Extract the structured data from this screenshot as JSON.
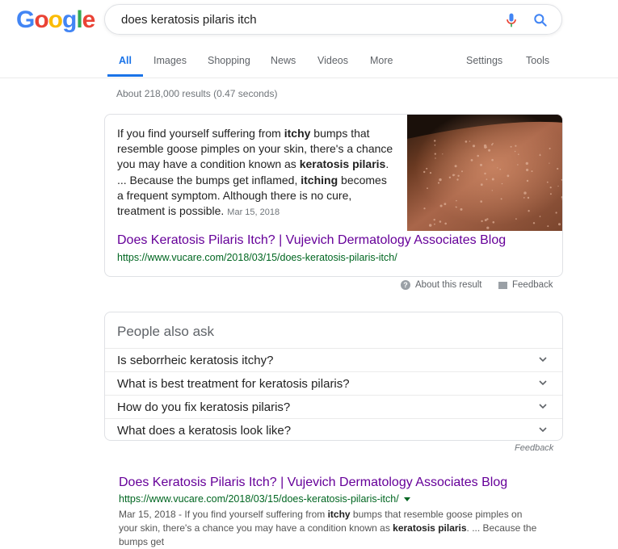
{
  "logo": {
    "letters": [
      "G",
      "o",
      "o",
      "g",
      "l",
      "e"
    ],
    "colors": [
      "#4285f4",
      "#ea4335",
      "#fbbc05",
      "#4285f4",
      "#34a853",
      "#ea4335"
    ]
  },
  "search": {
    "query": "does keratosis pilaris itch"
  },
  "tabs": [
    {
      "label": "All",
      "active": true
    },
    {
      "label": "Images"
    },
    {
      "label": "Shopping"
    },
    {
      "label": "News"
    },
    {
      "label": "Videos"
    },
    {
      "label": "More"
    },
    {
      "label": "Settings"
    },
    {
      "label": "Tools"
    }
  ],
  "stats": "About 218,000 results (0.47 seconds)",
  "featured_snippet": {
    "parts": [
      {
        "text": "If you find yourself suffering from ",
        "bold": false
      },
      {
        "text": "itchy",
        "bold": true
      },
      {
        "text": " bumps that resemble goose pimples on your skin, there's a chance you may have a condition known as ",
        "bold": false
      },
      {
        "text": "keratosis pilaris",
        "bold": true
      },
      {
        "text": ". ... Because the bumps get inflamed, ",
        "bold": false
      },
      {
        "text": "itching",
        "bold": true
      },
      {
        "text": " becomes a frequent symptom. Although there is no cure, treatment is possible.",
        "bold": false
      }
    ],
    "date": "Mar 15, 2018",
    "title": "Does Keratosis Pilaris Itch? | Vujevich Dermatology Associates Blog",
    "url": "https://www.vucare.com/2018/03/15/does-keratosis-pilaris-itch/"
  },
  "about_result": "About this result",
  "feedback": "Feedback",
  "people_also_ask": {
    "heading": "People also ask",
    "questions": [
      "Is seborrheic keratosis itchy?",
      "What is best treatment for keratosis pilaris?",
      "How do you fix keratosis pilaris?",
      "What does a keratosis look like?"
    ],
    "feedback": "Feedback"
  },
  "result": {
    "title": "Does Keratosis Pilaris Itch? | Vujevich Dermatology Associates Blog",
    "url": "https://www.vucare.com/2018/03/15/does-keratosis-pilaris-itch/",
    "date": "Mar 15, 2018",
    "desc_parts": [
      {
        "text": " - If you find yourself suffering from ",
        "bold": false
      },
      {
        "text": "itchy",
        "bold": true
      },
      {
        "text": " bumps that resemble goose pimples on your skin, there's a chance you may have a condition known as ",
        "bold": false
      },
      {
        "text": "keratosis pilaris",
        "bold": true
      },
      {
        "text": ". ... Because the bumps get",
        "bold": false
      }
    ]
  }
}
